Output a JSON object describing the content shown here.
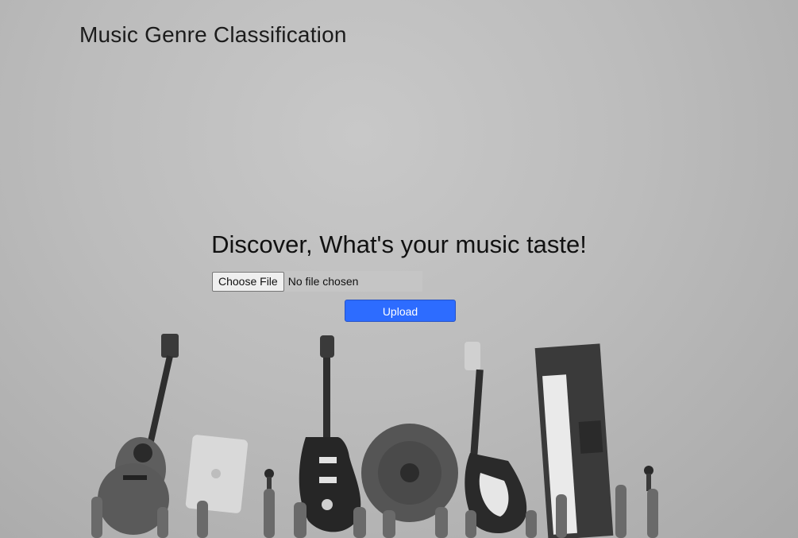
{
  "header": {
    "title": "Music Genre Classification"
  },
  "hero": {
    "heading": "Discover, What's your music taste!"
  },
  "upload_form": {
    "choose_file_label": "Choose File",
    "file_status": "No file chosen",
    "upload_label": "Upload"
  },
  "colors": {
    "upload_button": "#2d6cff",
    "background": "#bcbcbc"
  },
  "background_image": {
    "icons": [
      "acoustic-guitar-icon",
      "tablet-icon",
      "microphone-icon",
      "electric-guitar-icon",
      "cymbal-icon",
      "bass-guitar-icon",
      "keyboard-icon",
      "raised-hands-icon"
    ]
  }
}
